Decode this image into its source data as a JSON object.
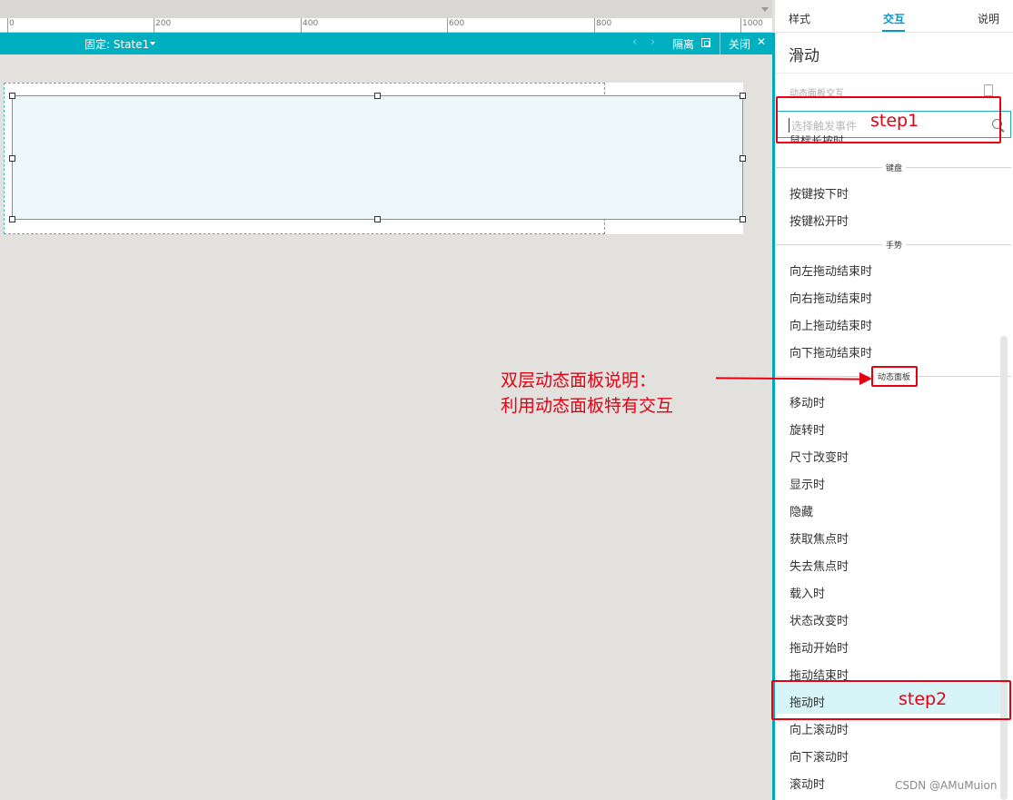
{
  "ruler": {
    "labels": [
      "0",
      "200",
      "400",
      "600",
      "800",
      "1000"
    ]
  },
  "state_bar": {
    "state_label": "固定: State1",
    "isolate_label": "隔离",
    "close_label": "关闭",
    "nav_left": "‹",
    "nav_right": "›",
    "close_glyph": "✕"
  },
  "right_panel": {
    "tabs": {
      "style": "样式",
      "interaction": "交互",
      "notes": "说明"
    },
    "title": "滑动",
    "section_faded": "动态面板交互",
    "search_placeholder": "选择触发事件",
    "clipped_item": "鼠标长按时",
    "groups": {
      "keyboard": "键盘",
      "gesture": "手势",
      "dynamic_panel": "动态面板"
    },
    "keyboard_events": [
      "按键按下时",
      "按键松开时"
    ],
    "gesture_events": [
      "向左拖动结束时",
      "向右拖动结束时",
      "向上拖动结束时",
      "向下拖动结束时"
    ],
    "panel_events": [
      "移动时",
      "旋转时",
      "尺寸改变时",
      "显示时",
      "隐藏",
      "获取焦点时",
      "失去焦点时",
      "载入时",
      "状态改变时",
      "拖动开始时",
      "拖动结束时",
      "拖动时",
      "向上滚动时",
      "向下滚动时",
      "滚动时"
    ],
    "highlighted_event": "拖动时"
  },
  "annotations": {
    "step1": "step1",
    "step2": "step2",
    "note_line1": "双层动态面板说明：",
    "note_line2": "利用动态面板特有交互",
    "color": "#e60012"
  },
  "watermark": "CSDN @AMuMuion",
  "colors": {
    "accent": "#00b0c0",
    "tab_active": "#0b94c7",
    "highlight": "#d7f4f8"
  }
}
